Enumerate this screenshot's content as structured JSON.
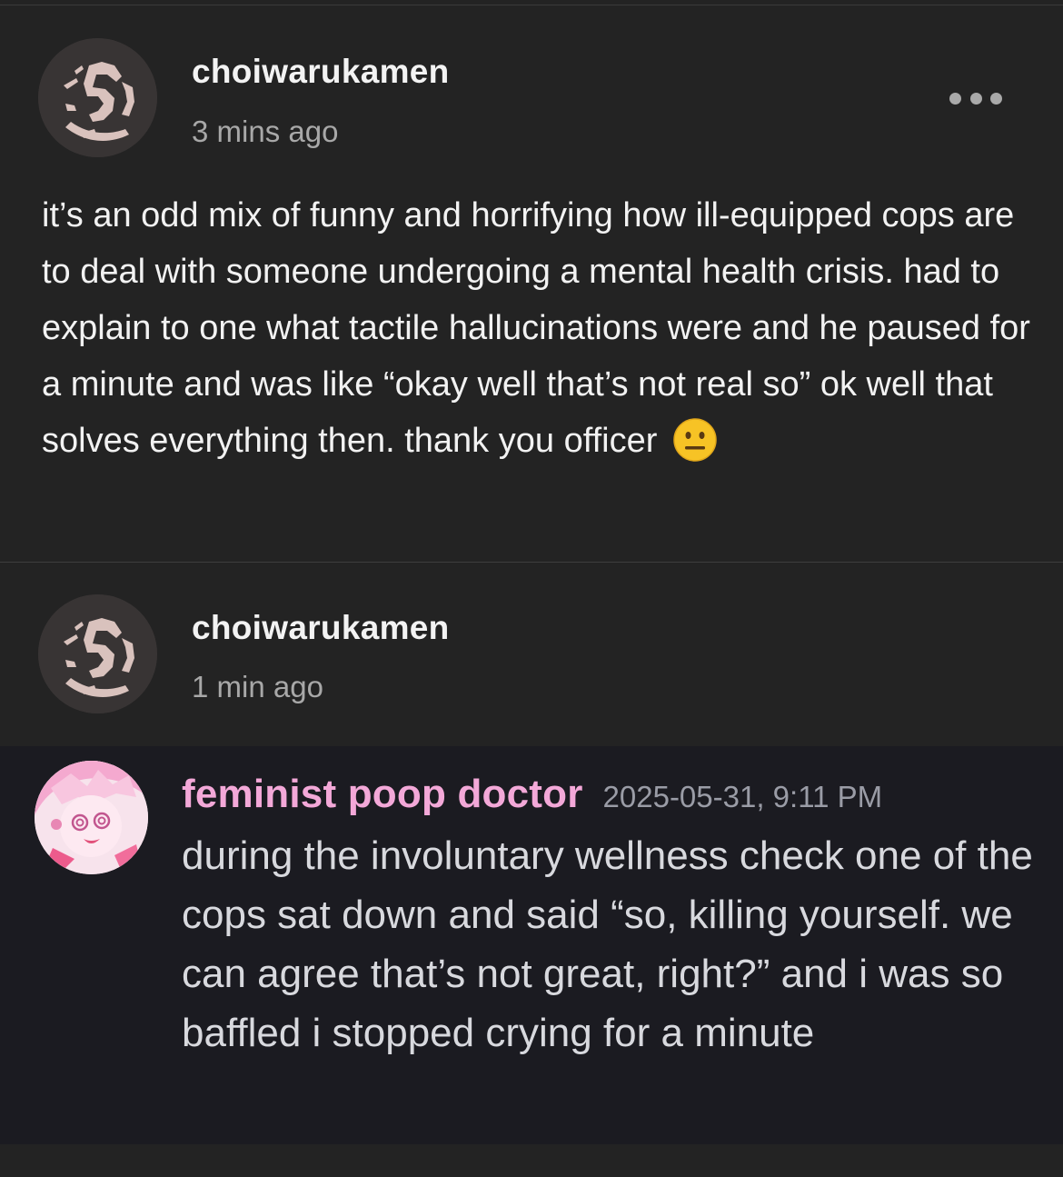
{
  "posts": [
    {
      "username": "choiwarukamen",
      "time": "3 mins ago",
      "text": "it’s an odd mix of funny and horrifying how ill-equipped cops are to deal with someone undergoing a mental health crisis. had to explain to one what tactile hallucinations were and he paused for a minute and was like “okay well that’s not real so” ok well that solves everything then. thank you officer",
      "emoji": "neutral-face-emoji"
    },
    {
      "username": "choiwarukamen",
      "time": "1 min ago"
    }
  ],
  "quote": {
    "username": "feminist poop doctor",
    "time": "2025-05-31, 9:11 PM",
    "text": "during the involuntary wellness check one of the cops sat down and said “so, killing yourself. we can agree that’s not great, right?” and i was so baffled i stopped crying for a minute"
  },
  "icons": {
    "more": "more-options-icon",
    "avatar": "logo-avatar"
  },
  "colors": {
    "background": "#232323",
    "quote_background": "#1b1b21",
    "quote_name": "#f3a8d8",
    "avatar_mark": "#d9c2bd"
  }
}
